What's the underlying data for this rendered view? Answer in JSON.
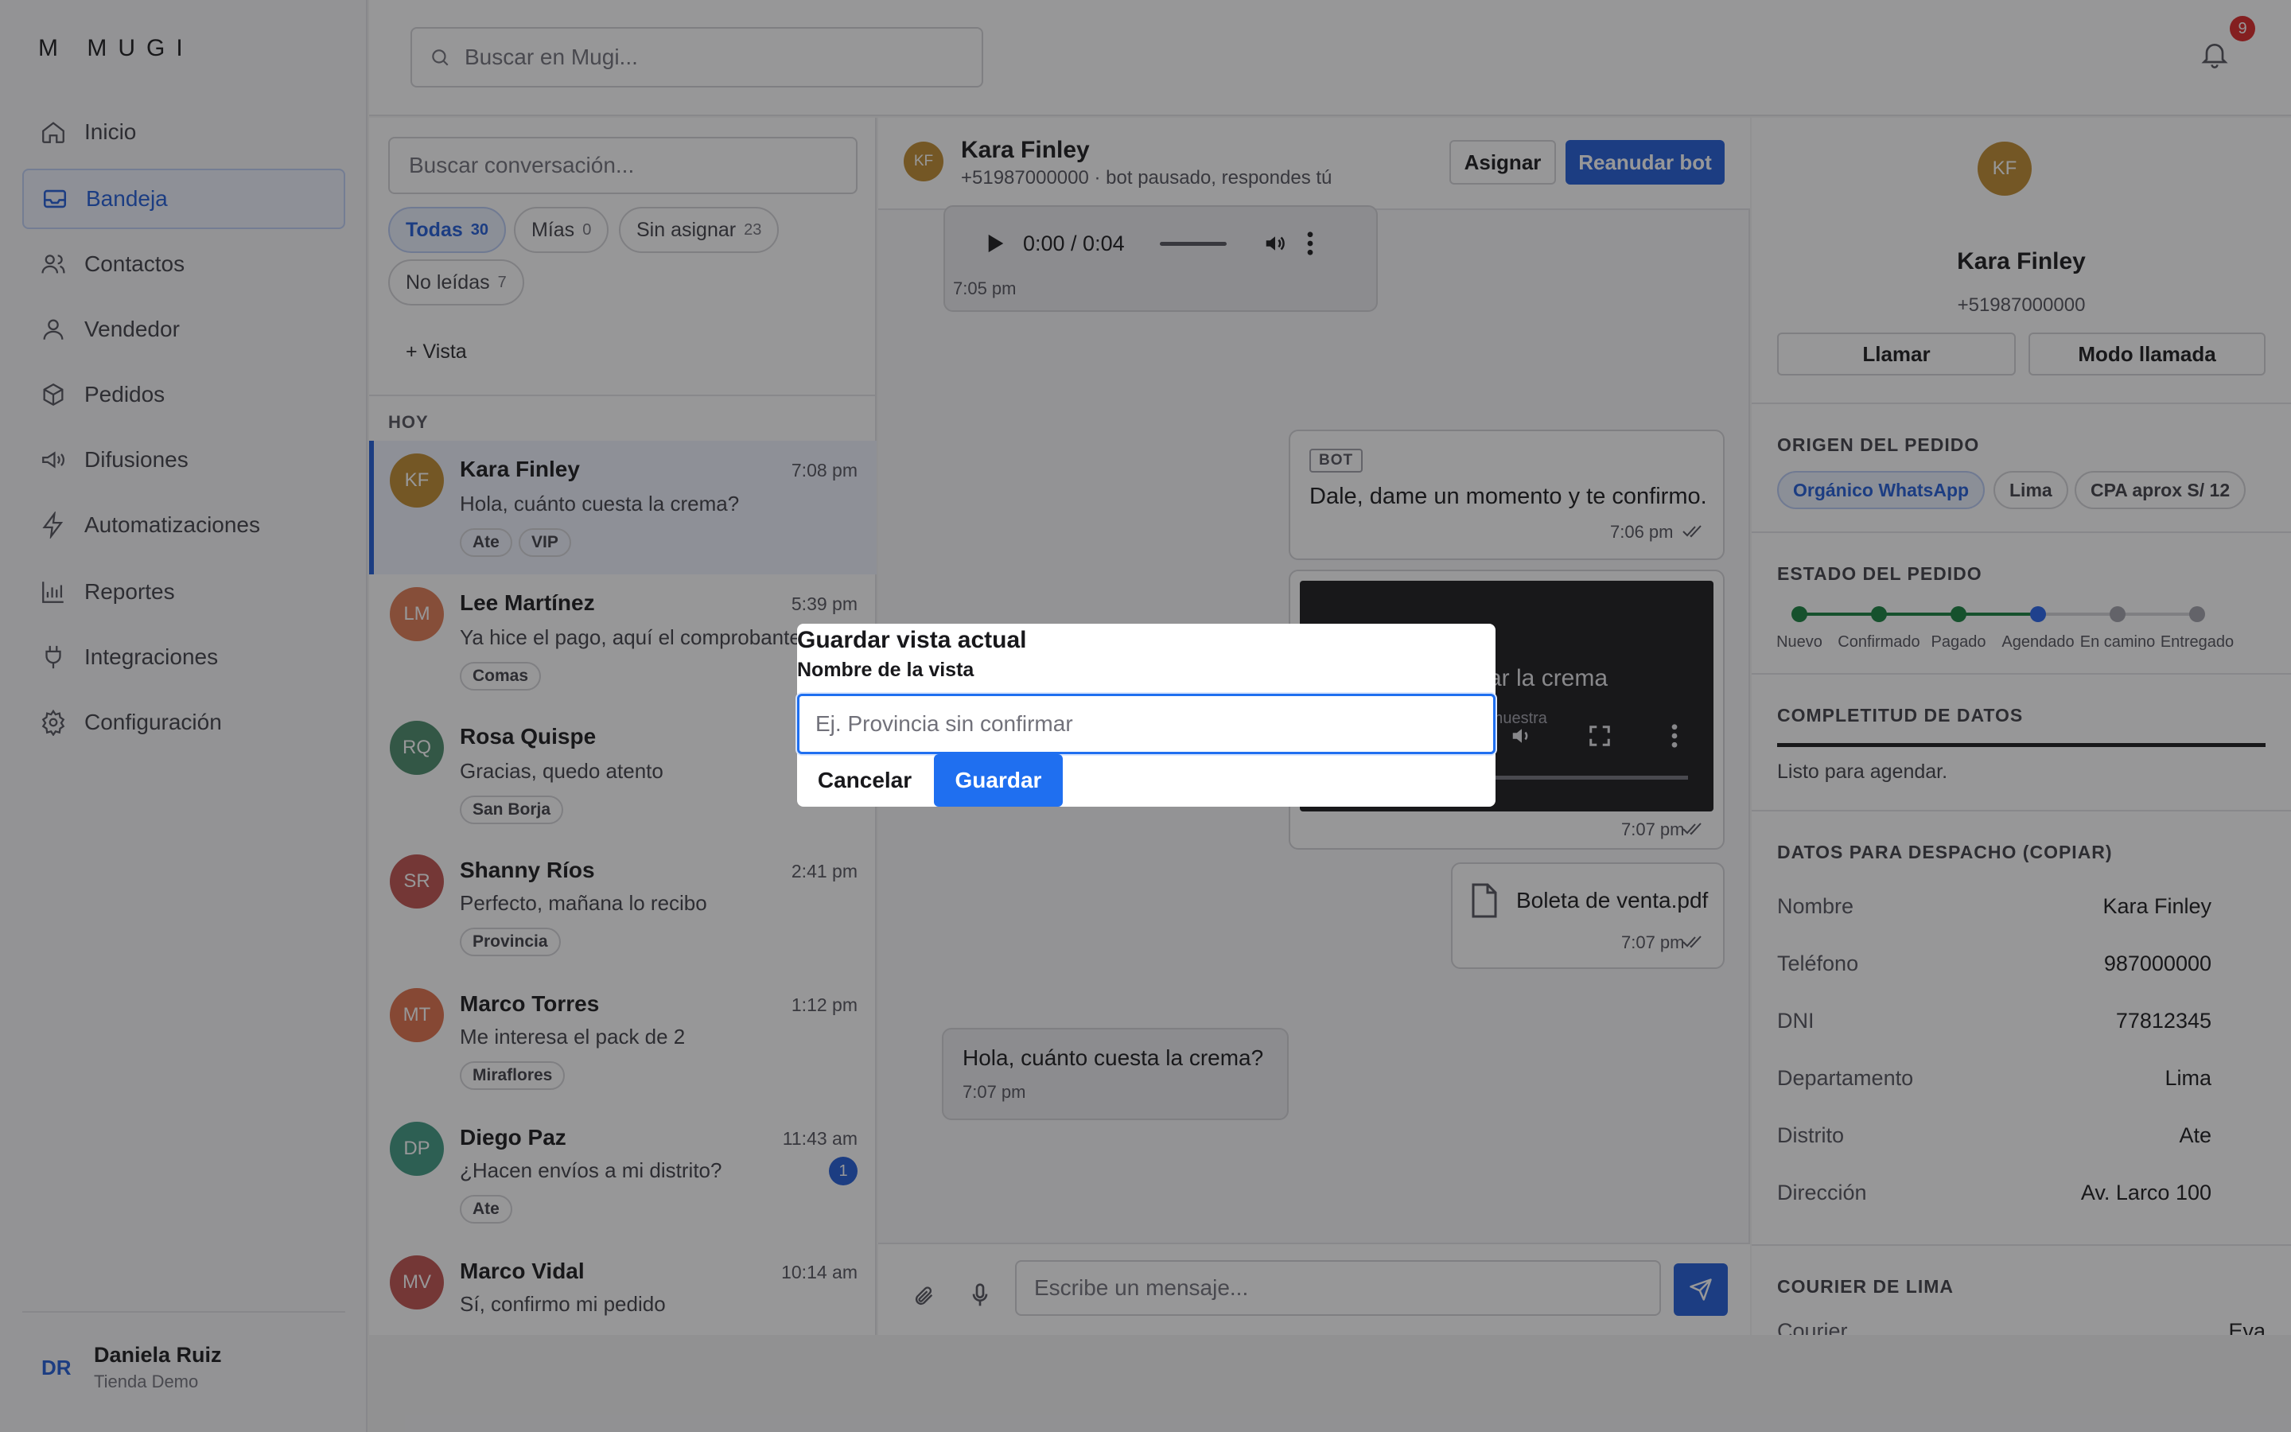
{
  "app": {
    "logo": "M MUGI"
  },
  "nav": {
    "items": [
      {
        "label": "Inicio"
      },
      {
        "label": "Bandeja"
      },
      {
        "label": "Contactos"
      },
      {
        "label": "Vendedor"
      },
      {
        "label": "Pedidos"
      },
      {
        "label": "Difusiones"
      },
      {
        "label": "Automatizaciones"
      },
      {
        "label": "Reportes"
      },
      {
        "label": "Integraciones"
      },
      {
        "label": "Configuración"
      }
    ],
    "active_index": 1
  },
  "user": {
    "initials": "DR",
    "name": "Daniela Ruiz",
    "store": "Tienda Demo"
  },
  "topbar": {
    "search_placeholder": "Buscar en Mugi...",
    "notification_count": "9"
  },
  "inbox": {
    "search_placeholder": "Buscar conversación...",
    "filters": [
      {
        "label": "Todas",
        "count": "30"
      },
      {
        "label": "Mías",
        "count": "0"
      },
      {
        "label": "Sin asignar",
        "count": "23"
      },
      {
        "label": "No leídas",
        "count": "7"
      }
    ],
    "add_view": "+ Vista",
    "day_label": "HOY",
    "conversations": [
      {
        "initials": "KF",
        "name": "Kara Finley",
        "time": "7:08 pm",
        "message": "Hola, cuánto cuesta la crema?",
        "tags": [
          "Ate",
          "VIP"
        ],
        "color": "#c08a2e"
      },
      {
        "initials": "LM",
        "name": "Lee Martínez",
        "time": "5:39 pm",
        "message": "Ya hice el pago, aquí el comprobante",
        "tags": [
          "Comas"
        ],
        "color": "#e07a52"
      },
      {
        "initials": "RQ",
        "name": "Rosa Quispe",
        "time": "",
        "message": "Gracias, quedo atento",
        "tags": [
          "San Borja"
        ],
        "color": "#4a8a6a"
      },
      {
        "initials": "SR",
        "name": "Shanny Ríos",
        "time": "2:41 pm",
        "message": "Perfecto, mañana lo recibo",
        "tags": [
          "Provincia"
        ],
        "color": "#c0504d"
      },
      {
        "initials": "MT",
        "name": "Marco Torres",
        "time": "1:12 pm",
        "message": "Me interesa el pack de 2",
        "tags": [
          "Miraflores"
        ],
        "color": "#e06f4a"
      },
      {
        "initials": "DP",
        "name": "Diego Paz",
        "time": "11:43 am",
        "message": "¿Hacen envíos a mi distrito?",
        "tags": [
          "Ate"
        ],
        "color": "#3f9a82",
        "unread": "1"
      },
      {
        "initials": "MV",
        "name": "Marco Vidal",
        "time": "10:14 am",
        "message": "Sí, confirmo mi pedido",
        "tags": [],
        "color": "#c0504d"
      }
    ]
  },
  "chat": {
    "initials": "KF",
    "name": "Kara Finley",
    "subtitle": "+51987000000 · bot pausado, respondes tú",
    "assign_label": "Asignar",
    "resume_label": "Reanudar bot",
    "audio": {
      "time": "0:00 / 0:04",
      "sent": "7:05 pm"
    },
    "bot_tag": "BOT",
    "bot_message": "Dale, dame un momento y te confirmo.",
    "bot_time": "7:06 pm",
    "video": {
      "overlay_text": "car la crema",
      "overlay_sub": "e muestra",
      "time": "7:07 pm"
    },
    "file": {
      "name": "Boleta de venta.pdf",
      "time": "7:07 pm"
    },
    "incoming": {
      "text": "Hola, cuánto cuesta la crema?",
      "time": "7:07 pm"
    },
    "composer_placeholder": "Escribe un mensaje..."
  },
  "contact": {
    "initials": "KF",
    "name": "Kara Finley",
    "phone": "+51987000000",
    "call_label": "Llamar",
    "call_mode_label": "Modo llamada",
    "origin_title": "ORIGEN DEL PEDIDO",
    "origin_chips": [
      "Orgánico WhatsApp",
      "Lima",
      "CPA aprox  S/ 12"
    ],
    "status_title": "ESTADO DEL PEDIDO",
    "steps": [
      "Nuevo",
      "Confirmado",
      "Pagado",
      "Agendado",
      "En camino",
      "Entregado"
    ],
    "current_step": 4,
    "completeness_title": "COMPLETITUD DE DATOS",
    "completeness_fraction": 1.0,
    "completeness_text": "Listo para agendar.",
    "dispatch_title": "DATOS PARA DESPACHO (COPIAR)",
    "dispatch": [
      {
        "label": "Nombre",
        "value": "Kara Finley"
      },
      {
        "label": "Teléfono",
        "value": "987000000"
      },
      {
        "label": "DNI",
        "value": "77812345"
      },
      {
        "label": "Departamento",
        "value": "Lima"
      },
      {
        "label": "Distrito",
        "value": "Ate"
      },
      {
        "label": "Dirección",
        "value": "Av. Larco 100"
      }
    ],
    "courier_title": "COURIER DE LIMA",
    "courier_label": "Courier",
    "courier_value": "Eva"
  },
  "modal": {
    "title": "Guardar vista actual",
    "label": "Nombre de la vista",
    "placeholder": "Ej. Provincia sin confirmar",
    "cancel": "Cancelar",
    "save": "Guardar"
  },
  "colors": {
    "accent": "#1f5bd8",
    "step_done": "#15803d",
    "step_current": "#2563eb",
    "step_pending": "#a1a1aa"
  }
}
